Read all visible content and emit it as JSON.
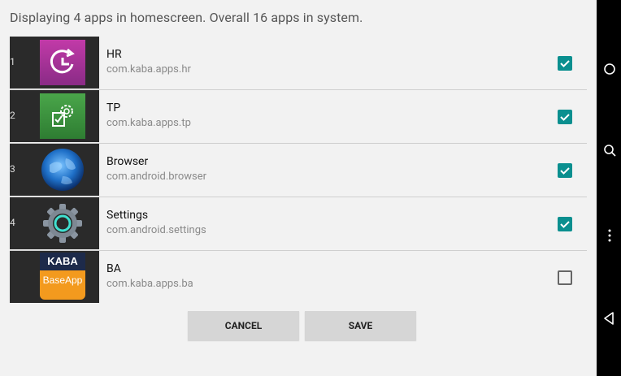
{
  "header": {
    "summary": "Displaying 4 apps in homescreen. Overall 16 apps in system."
  },
  "apps": [
    {
      "index": "1",
      "name": "HR",
      "package": "com.kaba.apps.hr",
      "checked": true,
      "icon": "hr-clock-icon"
    },
    {
      "index": "2",
      "name": "TP",
      "package": "com.kaba.apps.tp",
      "checked": true,
      "icon": "tp-gear-check-icon"
    },
    {
      "index": "3",
      "name": "Browser",
      "package": "com.android.browser",
      "checked": true,
      "icon": "globe-icon"
    },
    {
      "index": "4",
      "name": "Settings",
      "package": "com.android.settings",
      "checked": true,
      "icon": "settings-gear-icon"
    },
    {
      "index": "",
      "name": "BA",
      "package": "com.kaba.apps.ba",
      "checked": false,
      "icon": "kaba-baseapp-icon",
      "icon_text_top": "KABA",
      "icon_text_bottom": "BaseApp"
    }
  ],
  "buttons": {
    "cancel": "CANCEL",
    "save": "SAVE"
  },
  "colors": {
    "accent": "#0a8f8f",
    "navbar": "#000000"
  }
}
